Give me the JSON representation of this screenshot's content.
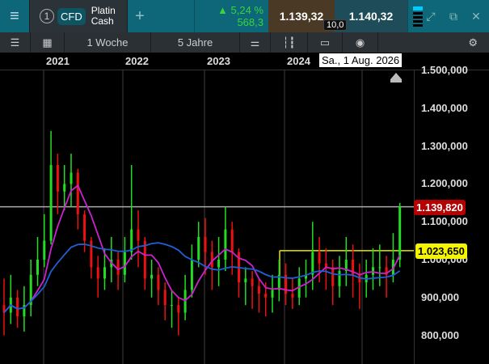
{
  "header": {
    "menu_icon": "hamburger-icon",
    "instrument_number": "1",
    "instrument_type": "CFD",
    "instrument_name_line1": "Platin",
    "instrument_name_line2": "Cash",
    "add_icon": "plus-icon",
    "change_percent": "5,24 %",
    "change_abs": "568,3",
    "change_direction": "up",
    "bid": "1.139,32",
    "ask": "1.140,32",
    "spread": "10,0",
    "colors": {
      "header": "#0d6779",
      "up": "#39d43a",
      "bid_bg": "#4a3a25",
      "ask_bg": "#1e4c58"
    }
  },
  "toolbar": {
    "interval": "1 Woche",
    "range": "5 Jahre"
  },
  "chart": {
    "hover_date": "Sa., 1 Aug. 2026",
    "year_labels": [
      "2021",
      "2022",
      "2023",
      "2024"
    ],
    "y_labels": [
      "1.500,000",
      "1.400,000",
      "1.300,000",
      "1.200,000",
      "1.100,000",
      "1.000,000",
      "900,000",
      "800,000"
    ],
    "last_price_label": "1.139,820",
    "last_price": 1139.82,
    "level_label": "1.023,650",
    "level": 1023.65
  },
  "chart_data": {
    "type": "candlestick",
    "x_start": "2020-07",
    "x_step": "1 month",
    "close": [
      860,
      900,
      850,
      880,
      960,
      1000,
      1050,
      1250,
      1180,
      1200,
      1230,
      1120,
      1050,
      980,
      950,
      980,
      1000,
      960,
      1020,
      1080,
      1050,
      950,
      960,
      920,
      880,
      880,
      860,
      920,
      1000,
      1060,
      1020,
      980,
      1000,
      1080,
      1020,
      940,
      950,
      930,
      910,
      900,
      920,
      960,
      910,
      900,
      950,
      960,
      1020,
      990,
      980,
      930,
      970,
      1000,
      960,
      940,
      960,
      980,
      980,
      960,
      1000,
      1139.82
    ],
    "high": [
      950,
      960,
      920,
      930,
      1000,
      1060,
      1120,
      1340,
      1280,
      1250,
      1280,
      1240,
      1130,
      1060,
      1010,
      1030,
      1060,
      1020,
      1060,
      1250,
      1130,
      1060,
      1000,
      980,
      940,
      920,
      900,
      960,
      1040,
      1100,
      1110,
      1050,
      1060,
      1140,
      1100,
      1030,
      980,
      970,
      950,
      940,
      960,
      1000,
      990,
      950,
      980,
      1000,
      1100,
      1060,
      1030,
      1000,
      1010,
      1060,
      1040,
      990,
      1000,
      1030,
      1040,
      1010,
      1070,
      1150
    ],
    "low": [
      800,
      830,
      820,
      810,
      850,
      930,
      980,
      1040,
      1120,
      1130,
      1140,
      1080,
      1020,
      950,
      900,
      920,
      940,
      920,
      940,
      1000,
      980,
      920,
      900,
      880,
      840,
      820,
      800,
      840,
      900,
      980,
      960,
      920,
      930,
      970,
      960,
      900,
      880,
      870,
      860,
      850,
      860,
      890,
      880,
      870,
      880,
      900,
      920,
      940,
      920,
      880,
      900,
      930,
      900,
      870,
      900,
      920,
      930,
      900,
      940,
      980
    ],
    "ylim": [
      760,
      1530
    ],
    "colors": {
      "up": "#22dd22",
      "down": "#ee1111",
      "ma_short": "#cc22cc",
      "ma_long": "#1f5fd6",
      "last": "#aaaaaa",
      "level": "#e6e600"
    }
  }
}
